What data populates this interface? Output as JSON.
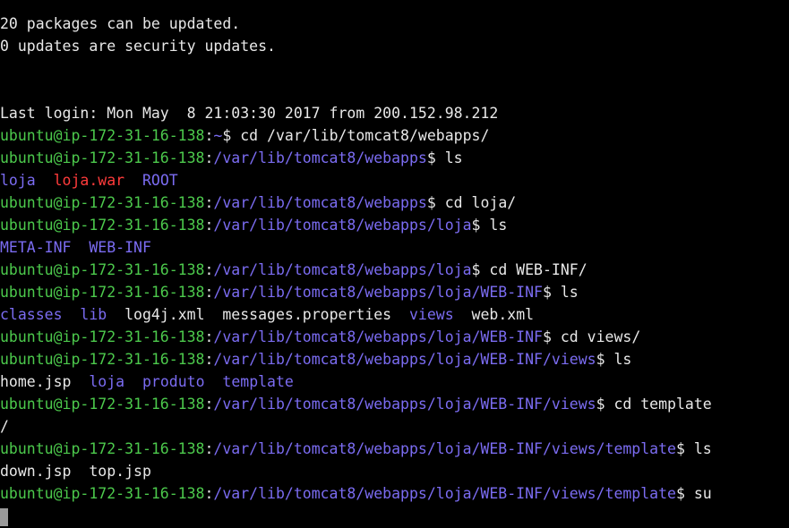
{
  "terminal": {
    "lines": [
      [
        {
          "t": "20 packages can be updated.",
          "c": "w"
        }
      ],
      [
        {
          "t": "0 updates are security updates.",
          "c": "w"
        }
      ],
      [],
      [],
      [
        {
          "t": "Last login: Mon May  8 21:03:30 2017 from 200.152.98.212",
          "c": "w"
        }
      ],
      [
        {
          "t": "ubuntu@ip-172-31-16-138",
          "c": "u"
        },
        {
          "t": ":",
          "c": "w"
        },
        {
          "t": "~",
          "c": "p"
        },
        {
          "t": "$ cd /var/lib/tomcat8/webapps/",
          "c": "w"
        }
      ],
      [
        {
          "t": "ubuntu@ip-172-31-16-138",
          "c": "u"
        },
        {
          "t": ":",
          "c": "w"
        },
        {
          "t": "/var/lib/tomcat8/webapps",
          "c": "p"
        },
        {
          "t": "$ ls",
          "c": "w"
        }
      ],
      [
        {
          "t": "loja",
          "c": "d"
        },
        {
          "t": "  ",
          "c": "w"
        },
        {
          "t": "loja.war",
          "c": "r"
        },
        {
          "t": "  ",
          "c": "w"
        },
        {
          "t": "ROOT",
          "c": "d"
        }
      ],
      [
        {
          "t": "ubuntu@ip-172-31-16-138",
          "c": "u"
        },
        {
          "t": ":",
          "c": "w"
        },
        {
          "t": "/var/lib/tomcat8/webapps",
          "c": "p"
        },
        {
          "t": "$ cd loja/",
          "c": "w"
        }
      ],
      [
        {
          "t": "ubuntu@ip-172-31-16-138",
          "c": "u"
        },
        {
          "t": ":",
          "c": "w"
        },
        {
          "t": "/var/lib/tomcat8/webapps/loja",
          "c": "p"
        },
        {
          "t": "$ ls",
          "c": "w"
        }
      ],
      [
        {
          "t": "META-INF",
          "c": "d"
        },
        {
          "t": "  ",
          "c": "w"
        },
        {
          "t": "WEB-INF",
          "c": "d"
        }
      ],
      [
        {
          "t": "ubuntu@ip-172-31-16-138",
          "c": "u"
        },
        {
          "t": ":",
          "c": "w"
        },
        {
          "t": "/var/lib/tomcat8/webapps/loja",
          "c": "p"
        },
        {
          "t": "$ cd WEB-INF/",
          "c": "w"
        }
      ],
      [
        {
          "t": "ubuntu@ip-172-31-16-138",
          "c": "u"
        },
        {
          "t": ":",
          "c": "w"
        },
        {
          "t": "/var/lib/tomcat8/webapps/loja/WEB-INF",
          "c": "p"
        },
        {
          "t": "$ ls",
          "c": "w"
        }
      ],
      [
        {
          "t": "classes",
          "c": "d"
        },
        {
          "t": "  ",
          "c": "w"
        },
        {
          "t": "lib",
          "c": "d"
        },
        {
          "t": "  log4j.xml  messages.properties  ",
          "c": "w"
        },
        {
          "t": "views",
          "c": "d"
        },
        {
          "t": "  web.xml",
          "c": "w"
        }
      ],
      [
        {
          "t": "ubuntu@ip-172-31-16-138",
          "c": "u"
        },
        {
          "t": ":",
          "c": "w"
        },
        {
          "t": "/var/lib/tomcat8/webapps/loja/WEB-INF",
          "c": "p"
        },
        {
          "t": "$ cd views/",
          "c": "w"
        }
      ],
      [
        {
          "t": "ubuntu@ip-172-31-16-138",
          "c": "u"
        },
        {
          "t": ":",
          "c": "w"
        },
        {
          "t": "/var/lib/tomcat8/webapps/loja/WEB-INF/views",
          "c": "p"
        },
        {
          "t": "$ ls",
          "c": "w"
        }
      ],
      [
        {
          "t": "home.jsp  ",
          "c": "w"
        },
        {
          "t": "loja",
          "c": "d"
        },
        {
          "t": "  ",
          "c": "w"
        },
        {
          "t": "produto",
          "c": "d"
        },
        {
          "t": "  ",
          "c": "w"
        },
        {
          "t": "template",
          "c": "d"
        }
      ],
      [
        {
          "t": "ubuntu@ip-172-31-16-138",
          "c": "u"
        },
        {
          "t": ":",
          "c": "w"
        },
        {
          "t": "/var/lib/tomcat8/webapps/loja/WEB-INF/views",
          "c": "p"
        },
        {
          "t": "$ cd template",
          "c": "w"
        }
      ],
      [
        {
          "t": "/",
          "c": "w"
        }
      ],
      [
        {
          "t": "ubuntu@ip-172-31-16-138",
          "c": "u"
        },
        {
          "t": ":",
          "c": "w"
        },
        {
          "t": "/var/lib/tomcat8/webapps/loja/WEB-INF/views/template",
          "c": "p"
        },
        {
          "t": "$ ls",
          "c": "w"
        }
      ],
      [
        {
          "t": "down.jsp  top.jsp",
          "c": "w"
        }
      ],
      [
        {
          "t": "ubuntu@ip-172-31-16-138",
          "c": "u"
        },
        {
          "t": ":",
          "c": "w"
        },
        {
          "t": "/var/lib/tomcat8/webapps/loja/WEB-INF/views/template",
          "c": "p"
        },
        {
          "t": "$ su",
          "c": "w"
        }
      ]
    ]
  },
  "colors": {
    "background": "#000000",
    "user_host": "#4cc94c",
    "path": "#7b6cf2",
    "directory": "#7b6cf2",
    "archive": "#ff3b3b",
    "text": "#e8e8e8"
  }
}
